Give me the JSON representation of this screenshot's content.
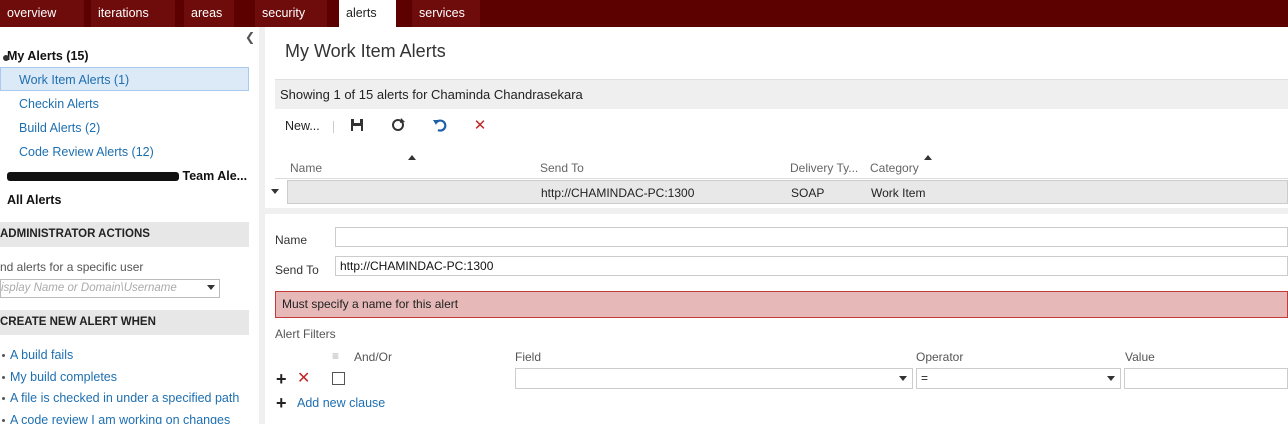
{
  "nav": {
    "tabs": [
      {
        "label": "overview"
      },
      {
        "label": "iterations"
      },
      {
        "label": "areas"
      },
      {
        "label": "security"
      },
      {
        "label": "alerts"
      },
      {
        "label": "services"
      }
    ],
    "active": "alerts"
  },
  "sidebar": {
    "my_alerts": "My Alerts (15)",
    "items": [
      {
        "label": "Work Item Alerts (1)"
      },
      {
        "label": "Checkin Alerts"
      },
      {
        "label": "Build Alerts (2)"
      },
      {
        "label": "Code Review Alerts (12)"
      }
    ],
    "team_alerts_suffix": "Team Ale...",
    "all_alerts": "All Alerts",
    "admin_header": "ADMINISTRATOR ACTIONS",
    "admin_text": "nd alerts for a specific user",
    "user_placeholder": "isplay Name or Domain\\Username",
    "create_header": "CREATE NEW ALERT WHEN",
    "create_links": [
      {
        "label": "A build fails"
      },
      {
        "label": "My build completes"
      },
      {
        "label": "A file is checked in under a specified path"
      },
      {
        "label": "A code review I am working on changes"
      }
    ]
  },
  "main": {
    "title": "My Work Item Alerts",
    "showing": "Showing 1 of 15 alerts for Chaminda Chandrasekara",
    "toolbar": {
      "new_label": "New..."
    },
    "columns": {
      "name": "Name",
      "send_to": "Send To",
      "delivery_type": "Delivery Ty...",
      "category": "Category"
    },
    "row": {
      "name": "",
      "send_to": "http://CHAMINDAC-PC:1300",
      "delivery_type": "SOAP",
      "category": "Work Item"
    },
    "form": {
      "name_label": "Name",
      "name_value": "",
      "send_to_label": "Send To",
      "send_to_value": "http://CHAMINDAC-PC:1300",
      "error": "Must specify a name for this alert",
      "filters_title": "Alert Filters",
      "andor": "And/Or",
      "field": "Field",
      "operator": "Operator",
      "value": "Value",
      "operator_value": "=",
      "add_clause": "Add new clause"
    }
  },
  "colors": {
    "nav_bg": "#5c0000",
    "link": "#1e6fb0",
    "error_bg": "#e6b9b8",
    "error_border": "#c23a3a"
  }
}
